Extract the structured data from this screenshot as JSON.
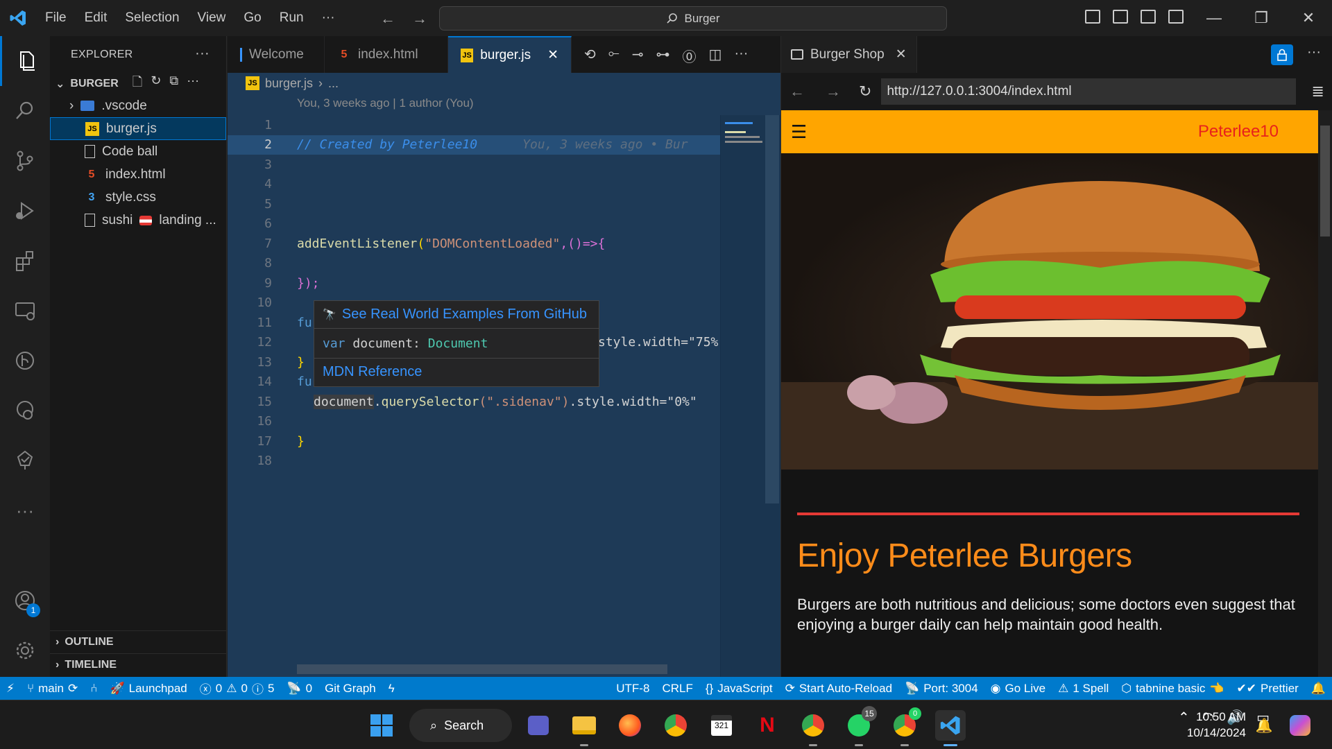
{
  "titlebar": {
    "menu": [
      "File",
      "Edit",
      "Selection",
      "View",
      "Go",
      "Run",
      "···"
    ],
    "command_center": "Burger"
  },
  "explorer": {
    "title": "EXPLORER",
    "folder": "BURGER",
    "items": [
      {
        "label": ".vscode",
        "icon": "folder-icon"
      },
      {
        "label": "burger.js",
        "icon": "js-file-icon"
      },
      {
        "label": "Code ball",
        "icon": "file-icon"
      },
      {
        "label": "index.html",
        "icon": "html-file-icon"
      },
      {
        "label": "style.css",
        "icon": "css-file-icon"
      },
      {
        "label": "sushi",
        "extra": "landing ...",
        "icon": "file-icon"
      }
    ],
    "outline": "OUTLINE",
    "timeline": "TIMELINE"
  },
  "editor": {
    "tabs": [
      {
        "label": "Welcome"
      },
      {
        "label": "index.html"
      },
      {
        "label": "burger.js",
        "close": "✕"
      }
    ],
    "breadcrumb": {
      "file": "burger.js",
      "rest": "..."
    },
    "blame_header": "You, 3 weeks ago | 1 author (You)",
    "line_numbers": [
      "1",
      "2",
      "3",
      "4",
      "5",
      "6",
      "7",
      "8",
      "9",
      "10",
      "11",
      "12",
      "13",
      "14",
      "15",
      "16",
      "17",
      "18"
    ],
    "code": {
      "l2_comment": "// Created by Peterlee10",
      "l2_ghost": "You, 3 weeks ago • Bur",
      "l7_fn": "addEventListener",
      "l7_p1": "(",
      "l7_str": "\"DOMContentLoaded\"",
      "l7_rest": ",()=>{",
      "l9": "});",
      "l11": "fu",
      "l12_tail": "style.width=\"75%",
      "l13": "}",
      "l14": "fu",
      "l15_obj": "document",
      "l15_dot": ".",
      "l15_fn": "querySelector",
      "l15_str": "(\".sidenav\")",
      "l15_tail": ".style.width=\"0%\"",
      "l17": "}"
    },
    "hover": {
      "link1": "See Real World Examples From GitHub",
      "kw": "var",
      "name": "document:",
      "type": "Document",
      "link2": "MDN Reference"
    }
  },
  "preview": {
    "tab": "Burger Shop",
    "url": "http://127.0.0.1:3004/index.html",
    "brand": "Peterlee10",
    "menu_icon": "☰",
    "headline": "Enjoy Peterlee Burgers",
    "paragraph": "Burgers are both nutritious and delicious; some doctors even suggest that enjoying a burger daily can help maintain good health."
  },
  "statusbar": {
    "branch": "main",
    "launchpad": "Launchpad",
    "errors": "0",
    "warnings": "0",
    "info": "5",
    "ports": "0",
    "git_graph": "Git Graph",
    "encoding": "UTF-8",
    "eol": "CRLF",
    "language": "JavaScript",
    "auto_reload": "Start Auto-Reload",
    "port": "Port: 3004",
    "go_live": "Go Live",
    "spell": "1 Spell",
    "tabnine": "tabnine basic",
    "prettier": "Prettier"
  },
  "taskbar": {
    "search": "Search",
    "time": "10:50 AM",
    "date": "10/14/2024",
    "whatsapp_badge": "15",
    "chrome_badge": "0"
  },
  "accounts_badge": "1",
  "colors": {
    "accent": "#007acc",
    "editor_bg": "#1e3a57",
    "site_header": "#ffa500",
    "headline": "#ff8c1a"
  }
}
